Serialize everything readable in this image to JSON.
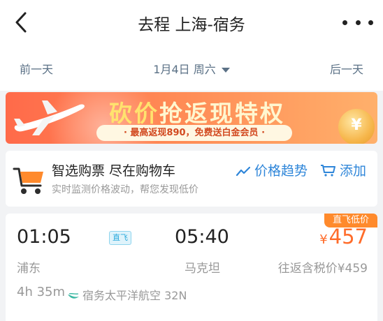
{
  "header": {
    "title": "去程 上海-宿务"
  },
  "datebar": {
    "prev": "前一天",
    "current": "1月4日 周六",
    "next": "后一天"
  },
  "banner": {
    "title_a": "砍价",
    "title_b": "抢返现特权",
    "subtitle": "· 最高返现890，免费送白金会员 ·",
    "coin_text": "¥"
  },
  "cart": {
    "title": "智选购票 尽在购物车",
    "subtitle": "实时监测价格波动，帮您发现低价",
    "trend_label": "价格趋势",
    "add_label": "添加"
  },
  "flight": {
    "tag": "直飞低价",
    "dep_time": "01:05",
    "arr_time": "05:40",
    "direct_badge": "直飞",
    "currency": "¥",
    "price": "457",
    "dep_city": "浦东",
    "arr_city": "马克坦",
    "round_trip": "往返含税价¥459",
    "duration": "4h 35m",
    "airline": "宿务太平洋航空 32N"
  },
  "colors": {
    "accent_blue": "#2f86d9",
    "price_orange": "#ff6c2a",
    "tag_orange": "#ff8a2c"
  }
}
